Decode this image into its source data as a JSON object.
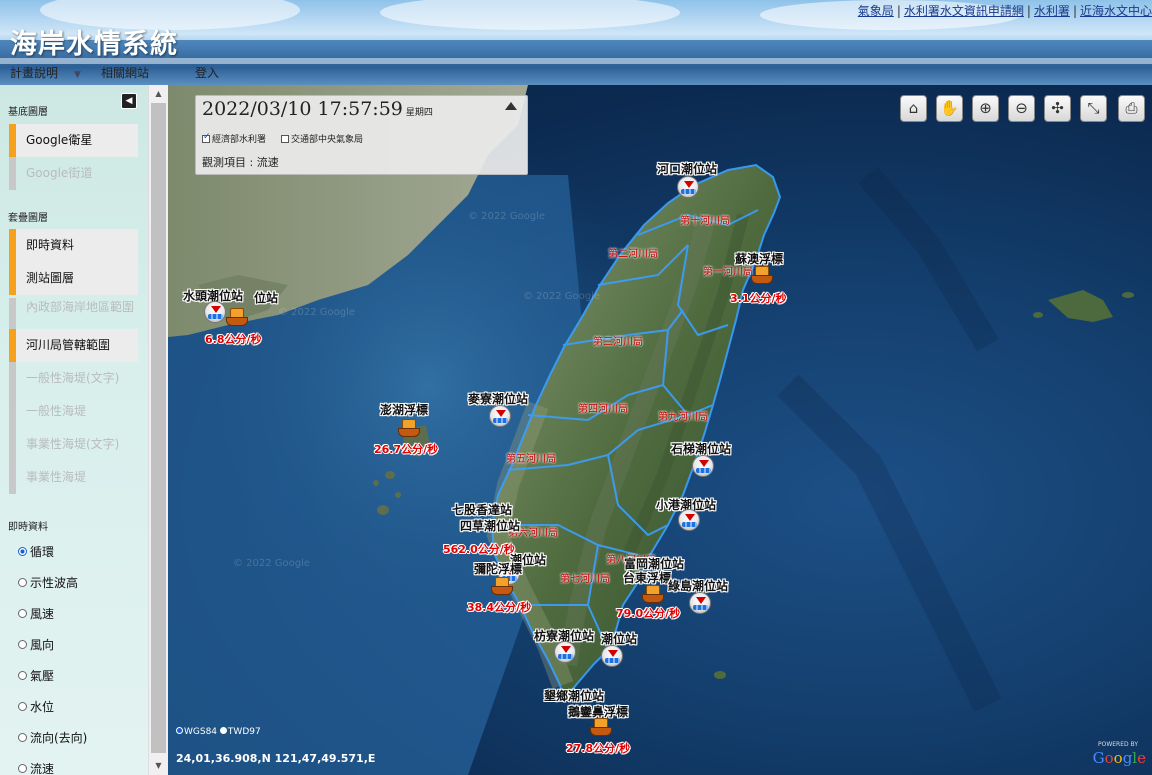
{
  "header": {
    "title": "海岸水情系統",
    "top_links": [
      "氣象局",
      "水利署水文資訊申請網",
      "水利署",
      "近海水文中心"
    ],
    "nav": [
      {
        "label": "計畫說明",
        "has_menu": true
      },
      {
        "label": "相關網站",
        "has_menu": false
      },
      {
        "label": "登入",
        "has_menu": false
      }
    ]
  },
  "sidebar": {
    "base_section": "基底圖層",
    "base_layers": [
      {
        "label": "Google衛星",
        "active": true
      },
      {
        "label": "Google街道",
        "active": false
      }
    ],
    "overlay_section": "套疊圖層",
    "overlay_layers": [
      {
        "label": "即時資料",
        "active": true
      },
      {
        "label": "測站圖層",
        "active": true
      },
      {
        "label": "內政部海岸地區範圍",
        "active": false
      },
      {
        "label": "河川局管轄範圍",
        "active": true
      },
      {
        "label": "一般性海堤(文字)",
        "active": false
      },
      {
        "label": "一般性海堤",
        "active": false
      },
      {
        "label": "事業性海堤(文字)",
        "active": false
      },
      {
        "label": "事業性海堤",
        "active": false
      }
    ],
    "realtime_section": "即時資料",
    "realtime_options": [
      {
        "label": "循環",
        "selected": true
      },
      {
        "label": "示性波高",
        "selected": false
      },
      {
        "label": "風速",
        "selected": false
      },
      {
        "label": "風向",
        "selected": false
      },
      {
        "label": "氣壓",
        "selected": false
      },
      {
        "label": "水位",
        "selected": false
      },
      {
        "label": "流向(去向)",
        "selected": false
      },
      {
        "label": "流速",
        "selected": false
      }
    ]
  },
  "info_panel": {
    "datetime": "2022/03/10 17:57:59",
    "weekday": "星期四",
    "sources": [
      {
        "label": "經濟部水利署",
        "checked": true
      },
      {
        "label": "交通部中央氣象局",
        "checked": false
      }
    ],
    "observation": "觀測項目 : 流速"
  },
  "tools": [
    "home-icon",
    "pan-hand-icon",
    "zoom-in-icon",
    "zoom-out-icon",
    "measure-icon",
    "profile-icon",
    "print-icon"
  ],
  "map": {
    "watermark": "© 2022 Google",
    "coord_systems": [
      {
        "label": "WGS84",
        "selected": true
      },
      {
        "label": "TWD97",
        "selected": false
      }
    ],
    "coordinates": "24,01,36.908,N 121,47,49.571,E",
    "logo": "Google",
    "powered_by": "POWERED BY",
    "stations": [
      {
        "name": "河口潮位站",
        "type": "tide"
      },
      {
        "name": "蘇澳浮標",
        "type": "buoy",
        "value": "3.1公分/秒"
      },
      {
        "name": "水頭潮位站",
        "type": "tide"
      },
      {
        "name": "位站",
        "type": "tide",
        "value": "6.8公分/秒"
      },
      {
        "name": "澎湖浮標",
        "type": "buoy",
        "value": "26.7公分/秒"
      },
      {
        "name": "麥寮潮位站",
        "type": "tide"
      },
      {
        "name": "石梯潮位站",
        "type": "tide"
      },
      {
        "name": "小港潮位站",
        "type": "tide"
      },
      {
        "name": "七股香達站",
        "type": "buoy"
      },
      {
        "name": "四草潮位站",
        "type": "tide",
        "value": "562.0公分/秒"
      },
      {
        "name": "潮位站",
        "type": "tide"
      },
      {
        "name": "彌陀浮標",
        "type": "buoy",
        "value": "38.4公分/秒"
      },
      {
        "name": "富岡潮位站",
        "type": "tide"
      },
      {
        "name": "台東浮標",
        "type": "buoy"
      },
      {
        "name": "綠島潮位站",
        "type": "tide",
        "value": "79.0公分/秒"
      },
      {
        "name": "枋寮潮位站",
        "type": "tide"
      },
      {
        "name": "潮位站",
        "type": "tide"
      },
      {
        "name": "墾鄉潮位站",
        "type": "tide"
      },
      {
        "name": "鵝鑾鼻浮標",
        "type": "buoy",
        "value": "27.8公分/秒"
      }
    ],
    "districts": [
      "第十河川局",
      "第二河川局",
      "第一河川局",
      "第三河川局",
      "第四河川局",
      "第九河川局",
      "第五河川局",
      "第六河川局",
      "第八河川局",
      "第七河川局"
    ]
  }
}
